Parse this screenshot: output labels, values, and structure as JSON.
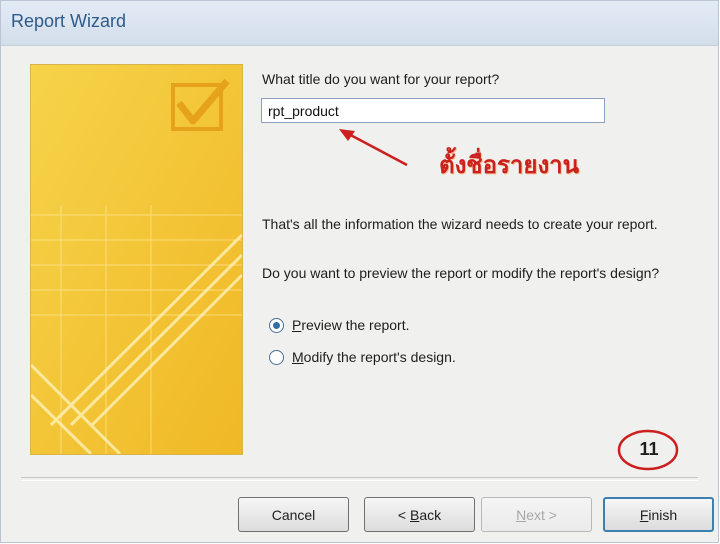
{
  "window": {
    "title": "Report Wizard"
  },
  "form": {
    "title_question": "What title do you want for your report?",
    "title_value": "rpt_product",
    "info_text": "That's all the information the wizard needs to create your report.",
    "preview_question": "Do you want to preview the report or modify the report's design?",
    "options": [
      {
        "mnemonic": "P",
        "rest": "review the report.",
        "selected": true
      },
      {
        "mnemonic": "M",
        "rest": "odify the report's design.",
        "selected": false
      }
    ]
  },
  "annotation": {
    "text": "ตั้งชื่อรายงาน",
    "step": "11"
  },
  "buttons": {
    "cancel": {
      "label": "Cancel"
    },
    "back": {
      "prefix": "< ",
      "mnemonic": "B",
      "rest": "ack"
    },
    "next": {
      "mnemonic": "N",
      "rest": "ext >"
    },
    "finish": {
      "mnemonic": "F",
      "rest": "inish"
    }
  },
  "colors": {
    "accent": "#2f5b8c",
    "annotation": "#cc1f1f",
    "graphic": "#f2c43a"
  }
}
